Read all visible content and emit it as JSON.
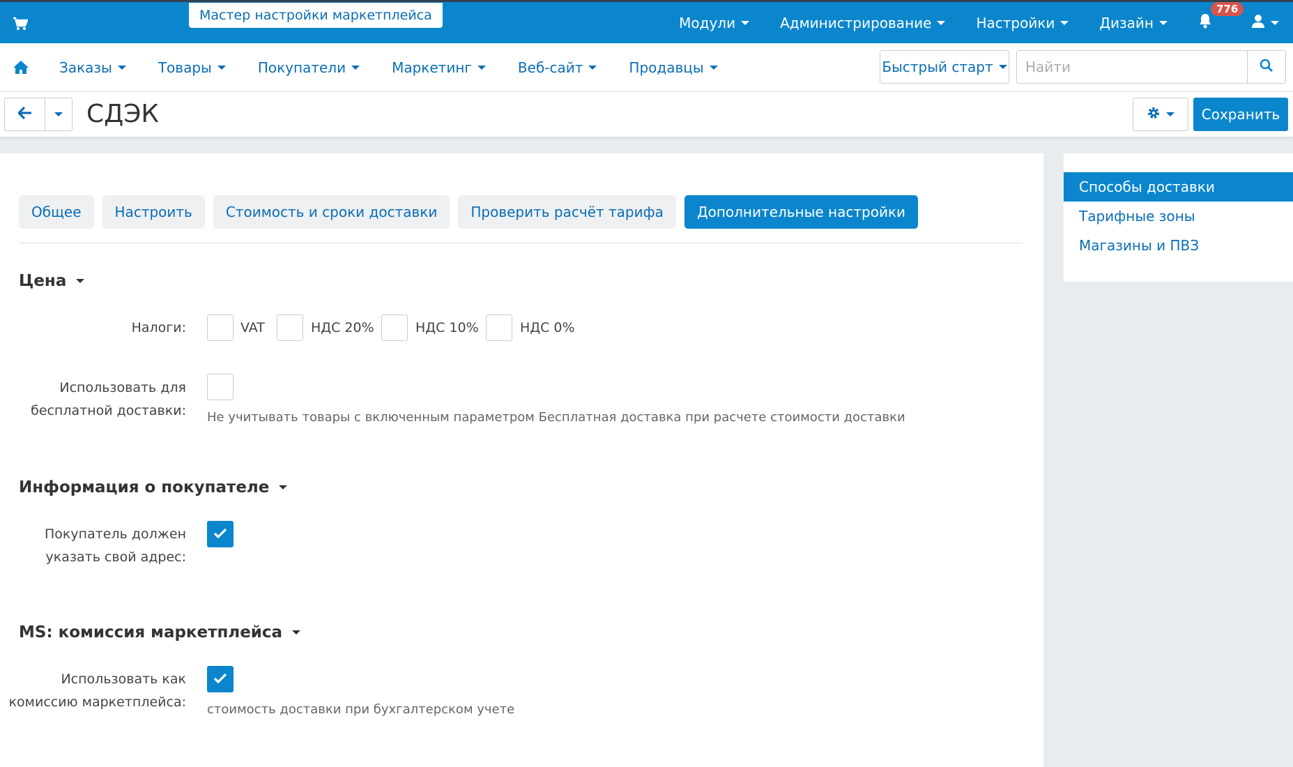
{
  "topbar": {
    "wizard_label": "Мастер настройки маркетплейса",
    "menu": [
      {
        "label": "Модули"
      },
      {
        "label": "Администрирование"
      },
      {
        "label": "Настройки"
      },
      {
        "label": "Дизайн"
      }
    ],
    "notifications_count": "776",
    "icons": [
      "cart-icon",
      "bell-icon",
      "user-icon"
    ],
    "color": "#0b86cd"
  },
  "nav": {
    "items": [
      {
        "label": "Заказы"
      },
      {
        "label": "Товары"
      },
      {
        "label": "Покупатели"
      },
      {
        "label": "Маркетинг"
      },
      {
        "label": "Веб-сайт"
      },
      {
        "label": "Продавцы"
      }
    ],
    "quick_start_label": "Быстрый старт",
    "search_placeholder": "Найти"
  },
  "page": {
    "title": "СДЭК",
    "save_label": "Сохранить"
  },
  "tabs": [
    {
      "label": "Общее",
      "active": false
    },
    {
      "label": "Настроить",
      "active": false
    },
    {
      "label": "Стоимость и сроки доставки",
      "active": false
    },
    {
      "label": "Проверить расчёт тарифа",
      "active": false
    },
    {
      "label": "Дополнительные настройки",
      "active": true
    }
  ],
  "sections": {
    "price": {
      "title": "Цена",
      "taxes_label": "Налоги:",
      "taxes": [
        {
          "label": "VAT",
          "checked": false
        },
        {
          "label": "НДС 20%",
          "checked": false
        },
        {
          "label": "НДС 10%",
          "checked": false
        },
        {
          "label": "НДС 0%",
          "checked": false
        }
      ],
      "free_delivery_label_line1": "Использовать для",
      "free_delivery_label_line2": "бесплатной доставки:",
      "free_delivery_checked": false,
      "free_delivery_hint": "Не учитывать товары с включенным параметром Бесплатная доставка при расчете стоимости доставки"
    },
    "customer": {
      "title": "Информация о покупателе",
      "address_label_line1": "Покупатель должен",
      "address_label_line2": "указать свой адрес:",
      "address_checked": true
    },
    "commission": {
      "title": "MS: комиссия маркетплейса",
      "use_label_line1": "Использовать как",
      "use_label_line2": "комиссию маркетплейса:",
      "use_checked": true,
      "hint": "стоимость доставки при бухгалтерском учете"
    }
  },
  "sidebar": {
    "items": [
      {
        "label": "Способы доставки",
        "active": true
      },
      {
        "label": "Тарифные зоны",
        "active": false
      },
      {
        "label": "Магазины и ПВЗ",
        "active": false
      }
    ]
  }
}
